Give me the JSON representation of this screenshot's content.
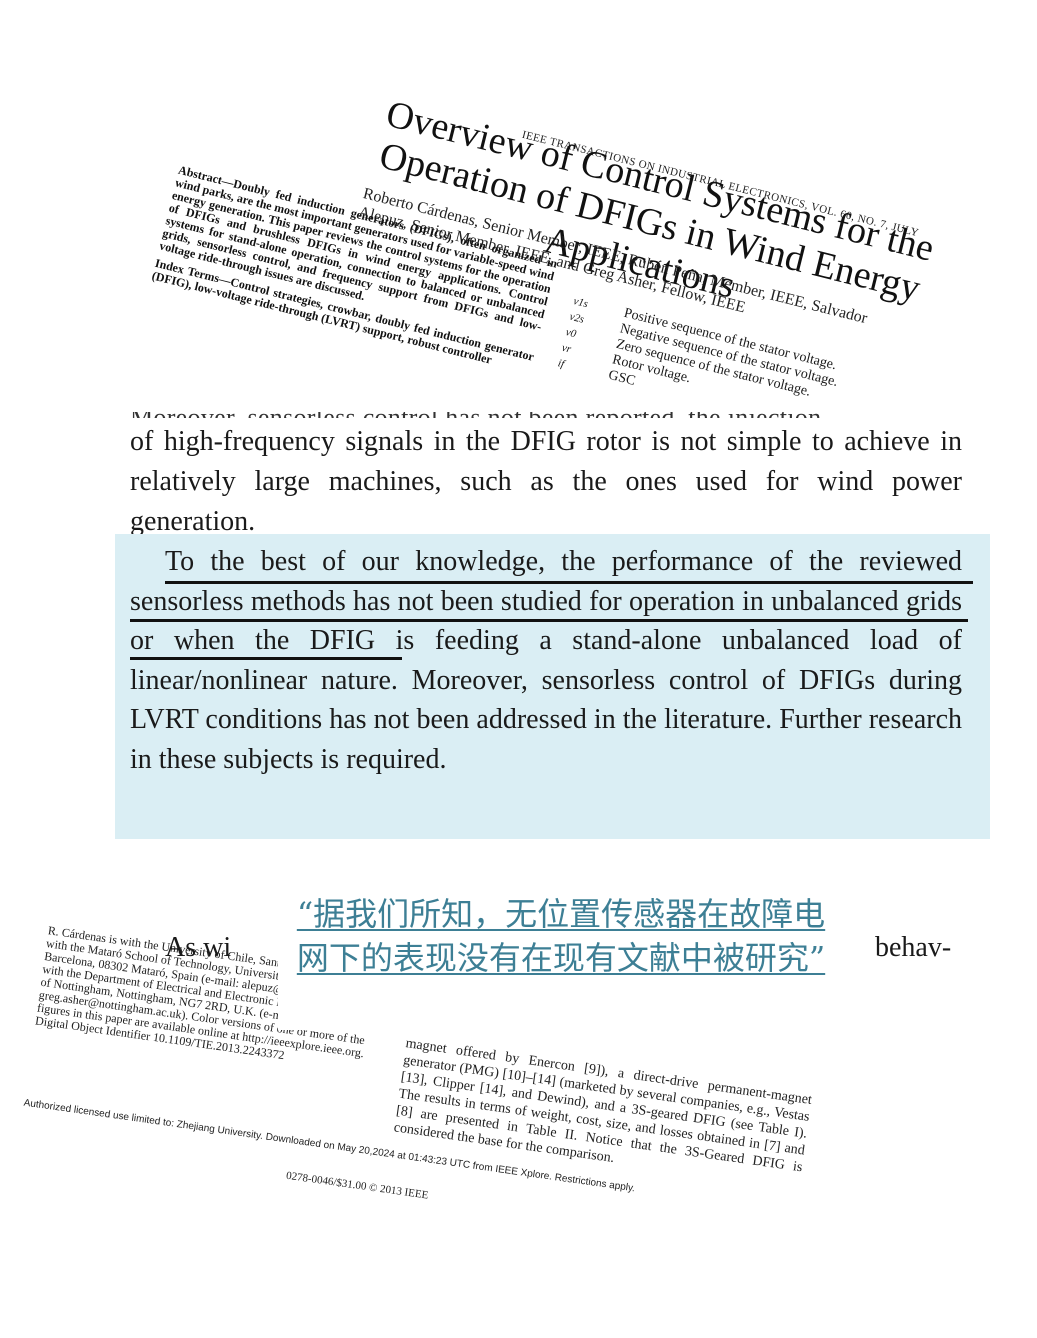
{
  "top_fragment": {
    "journal_header": "IEEE TRANSACTIONS ON INDUSTRIAL ELECTRONICS, VOL. 60, NO. 7, JULY",
    "title": "Overview of Control Systems for the Operation of DFIGs in Wind Energy Applications",
    "authors": "Roberto Cárdenas, Senior Member, IEEE, Rubén Peña, Member, IEEE, Salvador Alepuz, Senior Member, IEEE, and Greg Asher, Fellow, IEEE",
    "abstract": "Abstract—Doubly fed induction generators (DFIGs), often organized in wind parks, are the most important generators used for variable-speed wind energy generation. This paper reviews the control systems for the operation of DFIGs and brushless DFIGs in wind energy applications. Control systems for stand-alone operation, connection to balanced or unbalanced grids, sensorless control, and frequency support from DFIGs and low-voltage ride-through issues are discussed.",
    "index_terms": "Index Terms—Control strategies, crowbar, doubly fed induction generator (DFIG), low-voltage ride-through (LVRT) support, robust controller",
    "nomenclature": [
      {
        "symbol": "v1s",
        "desc": "Positive sequence of the stator voltage."
      },
      {
        "symbol": "v2s",
        "desc": "Negative sequence of the stator voltage."
      },
      {
        "symbol": "v0",
        "desc": "Zero sequence of the stator voltage."
      },
      {
        "symbol": "vr",
        "desc": "Rotor voltage."
      },
      {
        "symbol": "if",
        "desc": "GSC"
      }
    ]
  },
  "main": {
    "cropped_line": "Moreover, sensorless control has not been reported, the injection",
    "para1": "of high-frequency signals in the DFIG rotor is not simple to achieve in relatively large machines, such as the ones used for wind power generation.",
    "para2": "To the best of our knowledge, the performance of the reviewed sensorless methods has not been studied for operation in unbalanced grids or when the DFIG is feeding a stand-alone unbalanced load of linear/nonlinear nature. Moreover, sensorless control of DFIGs during LVRT conditions has not been addressed in the literature. Further research in these subjects is required.",
    "highlight_color": "#daeef4"
  },
  "bottom_fragment": {
    "affiliation": "R. Cárdenas is with the University of Chile, Santiago, Chile. S. Alepuz is with the Mataró School of Technology, Universitat Politècnica de Barcelona, 08302 Mataró, Spain (e-mail: alepuz@eupmt.es). G. Asher is with the Department of Electrical and Electronic Engineering, University of Nottingham, Nottingham, NG7 2RD, U.K. (e-mail: greg.asher@nottingham.ac.uk). Color versions of one or more of the figures in this paper are available online at http://ieeexplore.ieee.org. Digital Object Identifier 10.1109/TIE.2013.2243372",
    "right_column": "magnet offered by Enercon [9]), a direct-drive permanent-magnet generator (PMG) [10]–[14] (marketed by several companies, e.g., Vestas [13], Clipper [14], and Dewind), and a 3S-geared DFIG (see Table I). The results in terms of weight, cost, size, and losses obtained in [7] and [8] are presented in Table II. Notice that the 3S-Geared DFIG is considered the base for the comparison.",
    "license": "Authorized licensed use limited to: Zhejiang University. Downloaded on May 20,2024 at 01:43:23 UTC from IEEE Xplore. Restrictions apply.",
    "copyright": "0278-0046/$31.00 © 2013 IEEE",
    "as_line_start": "As wi",
    "as_line_end": "behav-"
  },
  "caption": {
    "text": "“据我们所知，无位置传感器在故障电网下的表现没有在现有文献中被研究”",
    "color": "#3d7f95"
  }
}
